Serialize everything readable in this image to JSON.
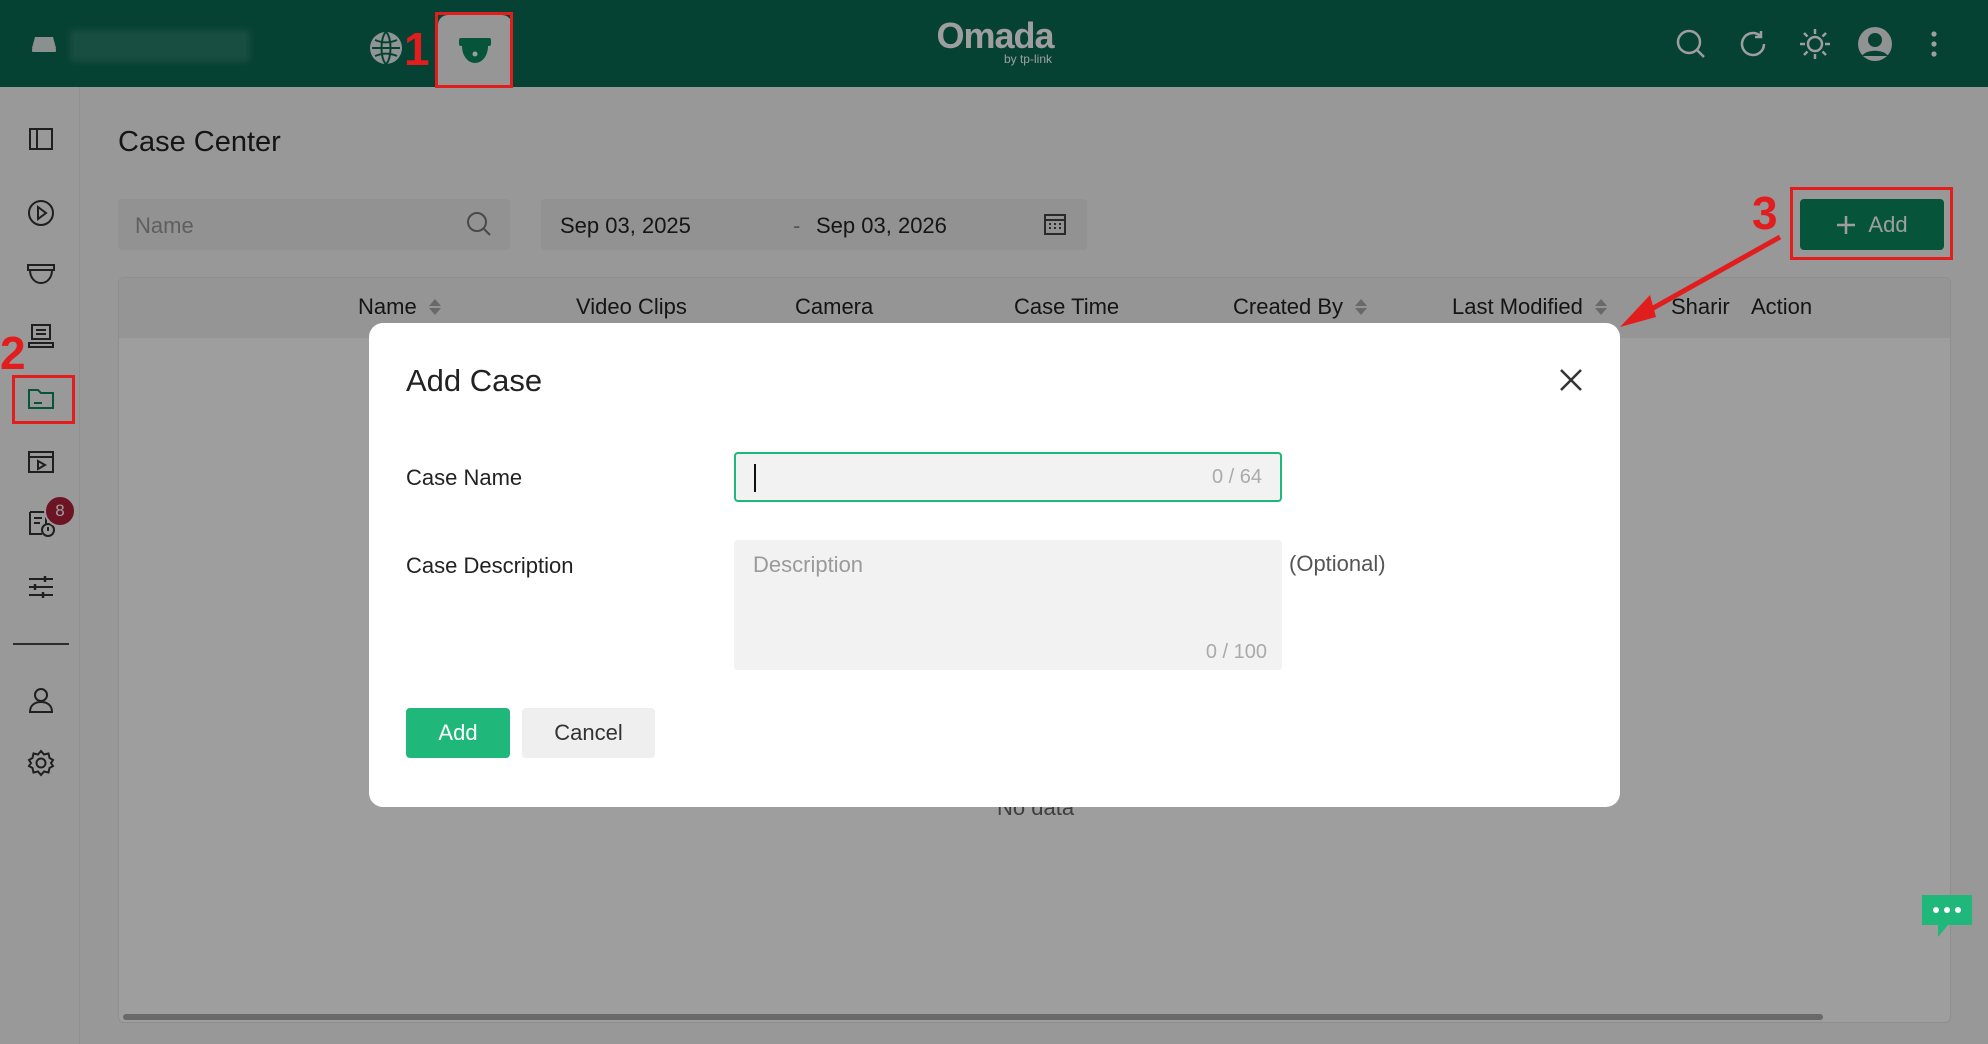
{
  "header": {
    "brand_name": "Omada",
    "brand_sub": "by tp-link",
    "icons": [
      "host-icon",
      "globe-icon",
      "camera-icon",
      "search-icon",
      "refresh-icon",
      "theme-icon",
      "avatar",
      "more-icon"
    ]
  },
  "sidebar": {
    "items": [
      "panel-icon",
      "playback-icon",
      "camera-icon",
      "device-icon",
      "case-center-icon",
      "video-icon",
      "alerts-icon",
      "settings-sliders-icon",
      "user-icon",
      "gear-icon"
    ],
    "alert_badge": "8"
  },
  "page": {
    "title": "Case Center",
    "search_placeholder": "Name",
    "date_start": "Sep 03, 2025",
    "date_sep": "-",
    "date_end": "Sep 03, 2026",
    "add_label": "Add",
    "empty_text": "No data"
  },
  "table": {
    "columns": [
      "Name",
      "Video Clips",
      "Camera",
      "Case Time",
      "Created By",
      "Last Modified",
      "Sharir",
      "Action"
    ]
  },
  "callouts": [
    "1",
    "2",
    "3"
  ],
  "modal": {
    "title": "Add Case",
    "case_name_label": "Case Name",
    "case_name_value": "",
    "case_name_counter": "0 / 64",
    "case_desc_label": "Case Description",
    "case_desc_placeholder": "Description",
    "case_desc_counter": "0 / 100",
    "optional_label": "(Optional)",
    "add_label": "Add",
    "cancel_label": "Cancel"
  },
  "colors": {
    "topbar": "#0b6b55",
    "accent": "#1fb77a",
    "callout": "#e21d1d",
    "badge": "#b0213a"
  }
}
